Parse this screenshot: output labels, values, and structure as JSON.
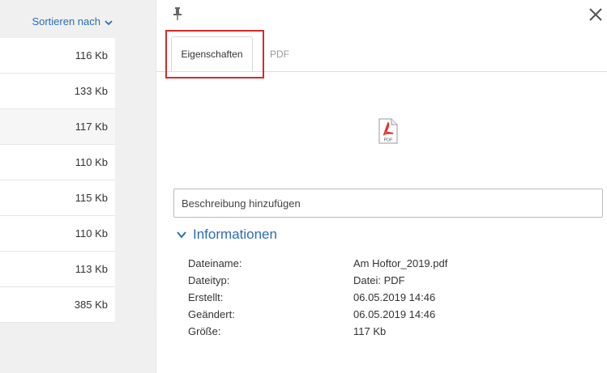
{
  "list": {
    "sort_label": "Sortieren nach",
    "rows": [
      "116 Kb",
      "133 Kb",
      "117 Kb",
      "110 Kb",
      "115 Kb",
      "110 Kb",
      "113 Kb",
      "385 Kb"
    ]
  },
  "details": {
    "tabs": [
      "Eigenschaften",
      "PDF"
    ],
    "file_icon_label": "PDF",
    "description_placeholder": "Beschreibung hinzufügen",
    "info_heading": "Informationen",
    "props": [
      {
        "key": "Dateiname:",
        "value": "Am Hoftor_2019.pdf"
      },
      {
        "key": "Dateityp:",
        "value": "Datei: PDF"
      },
      {
        "key": "Erstellt:",
        "value": "06.05.2019 14:46"
      },
      {
        "key": "Geändert:",
        "value": "06.05.2019 14:46"
      },
      {
        "key": "Größe:",
        "value": "117 Kb"
      }
    ]
  },
  "colors": {
    "accent": "#2a6db4",
    "highlight": "#d62b2b",
    "pdf_red": "#e0302a"
  }
}
